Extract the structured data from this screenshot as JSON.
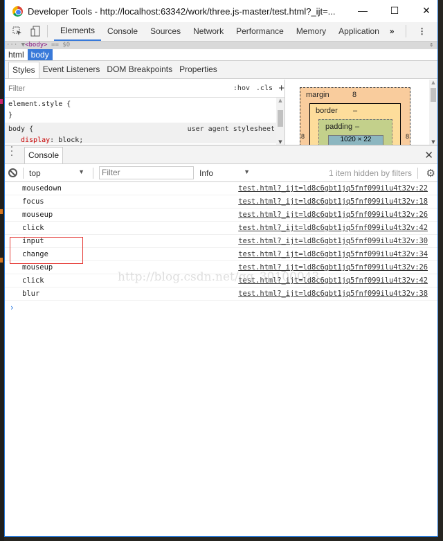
{
  "window": {
    "title": "Developer Tools - http://localhost:63342/work/three.js-master/test.html?_ijt=...",
    "minimize": "—",
    "maximize": "☐",
    "close": "✕"
  },
  "toolbar": {
    "inspect_icon": "inspect-element-icon",
    "device_icon": "device-toolbar-icon",
    "tabs": [
      "Elements",
      "Console",
      "Sources",
      "Network",
      "Performance",
      "Memory",
      "Application"
    ],
    "active_tab": "Elements",
    "more_tabs": "»",
    "menu": "⋮"
  },
  "elements": {
    "selected_node_prefix": "··· ▼",
    "selected_node_tag": "<body>",
    "selected_node_suffix": " == $0",
    "breadcrumbs": [
      "html",
      "body"
    ],
    "selected_breadcrumb": "body"
  },
  "sidebar": {
    "tabs": [
      "Styles",
      "Event Listeners",
      "DOM Breakpoints",
      "Properties"
    ],
    "active_tab": "Styles",
    "filter_placeholder": "Filter",
    "hov": ":hov",
    "cls": ".cls",
    "add": "+",
    "rules": [
      {
        "selector": "element.style {",
        "close": "}"
      },
      {
        "selector": "body {",
        "origin": "user agent stylesheet",
        "property": "display",
        "value": "block;"
      }
    ],
    "box_model": {
      "margin_label": "margin",
      "margin_top": "8",
      "margin_left": "8",
      "margin_right": "8",
      "border_label": "border",
      "border_top": "–",
      "padding_label": "padding",
      "padding_top": "–",
      "content": "1020 × 22"
    }
  },
  "drawer": {
    "tab": "Console",
    "close": "✕"
  },
  "console": {
    "context": "top",
    "filter_placeholder": "Filter",
    "level": "Info",
    "hidden_msg": "1 item hidden by filters",
    "messages": [
      {
        "text": "mousedown",
        "source": "test.html?_ijt=ld8c6gbt1jq5fnf099ilu4t32v:22"
      },
      {
        "text": "focus",
        "source": "test.html?_ijt=ld8c6gbt1jq5fnf099ilu4t32v:18"
      },
      {
        "text": "mouseup",
        "source": "test.html?_ijt=ld8c6gbt1jq5fnf099ilu4t32v:26"
      },
      {
        "text": "click",
        "source": "test.html?_ijt=ld8c6gbt1jq5fnf099ilu4t32v:42"
      },
      {
        "text": "input",
        "source": "test.html?_ijt=ld8c6gbt1jq5fnf099ilu4t32v:30"
      },
      {
        "text": "change",
        "source": "test.html?_ijt=ld8c6gbt1jq5fnf099ilu4t32v:34"
      },
      {
        "text": "mouseup",
        "source": "test.html?_ijt=ld8c6gbt1jq5fnf099ilu4t32v:26"
      },
      {
        "text": "click",
        "source": "test.html?_ijt=ld8c6gbt1jq5fnf099ilu4t32v:42"
      },
      {
        "text": "blur",
        "source": "test.html?_ijt=ld8c6gbt1jq5fnf099ilu4t32v:38"
      }
    ],
    "prompt": "›",
    "highlight_color": "#e53935"
  },
  "watermark": "http://blog.csdn.net/qq_30100043",
  "colors": {
    "accent": "#3879d9",
    "window_border": "#2b7ad6",
    "background": "#262521"
  }
}
